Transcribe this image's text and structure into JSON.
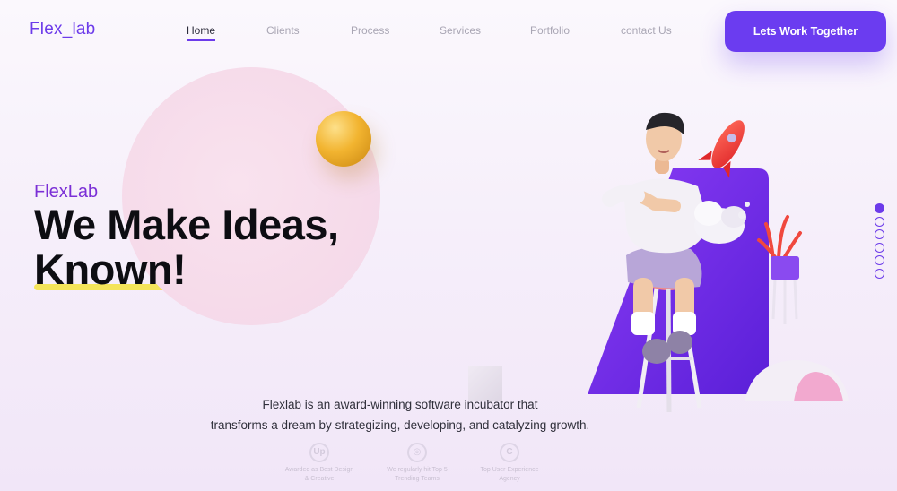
{
  "brand": {
    "logo": "Flex_lab",
    "accent": "#6c3bea"
  },
  "nav": {
    "items": [
      {
        "label": "Home",
        "active": true
      },
      {
        "label": "Clients",
        "active": false
      },
      {
        "label": "Process",
        "active": false
      },
      {
        "label": "Services",
        "active": false
      },
      {
        "label": "Portfolio",
        "active": false
      },
      {
        "label": "contact Us",
        "active": false
      }
    ],
    "cta_label": "Lets Work Together"
  },
  "hero": {
    "tag": "FlexLab",
    "title_line1": "We Make Ideas,",
    "title_line2": "Known!",
    "description_line1": "Flexlab is an award-winning software incubator that",
    "description_line2": "transforms a dream by strategizing, developing, and catalyzing growth."
  },
  "badges": [
    {
      "icon": "upwork-icon",
      "glyph": "Up",
      "line1": "Awarded as Best Design",
      "line2": "& Creative"
    },
    {
      "icon": "dribbble-icon",
      "glyph": "◎",
      "line1": "We regularly hit Top 5",
      "line2": "Trending Teams"
    },
    {
      "icon": "clutch-icon",
      "glyph": "C",
      "line1": "Top User Experience",
      "line2": "Agency"
    }
  ],
  "slider": {
    "count": 6,
    "active_index": 0
  }
}
